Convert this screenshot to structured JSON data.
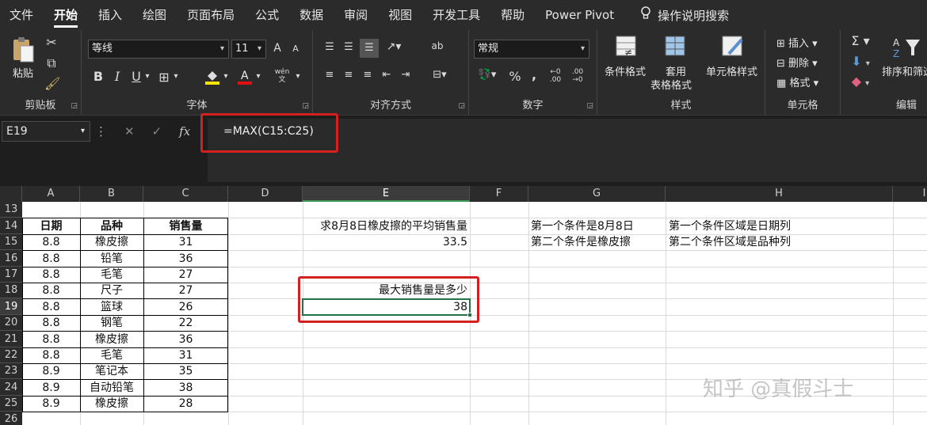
{
  "menu": {
    "tabs": [
      "文件",
      "开始",
      "插入",
      "绘图",
      "页面布局",
      "公式",
      "数据",
      "审阅",
      "视图",
      "开发工具",
      "帮助",
      "Power Pivot"
    ],
    "active_tab": "开始",
    "search_label": "操作说明搜索"
  },
  "ribbon": {
    "clipboard": {
      "paste": "粘贴",
      "label": "剪贴板"
    },
    "font": {
      "name": "等线",
      "size": "11",
      "label": "字体",
      "bold": "B",
      "italic": "I",
      "underline": "U",
      "grow": "A",
      "shrink": "A",
      "wen": "wén"
    },
    "alignment": {
      "label": "对齐方式",
      "wrap": "ab"
    },
    "number": {
      "format": "常规",
      "label": "数字",
      "percent": "%",
      "comma": ","
    },
    "styles": {
      "conditional": "条件格式",
      "table_line1": "套用",
      "table_line2": "表格格式",
      "cell_styles": "单元格样式",
      "label": "样式"
    },
    "cells": {
      "insert": "插入",
      "delete": "删除",
      "format": "格式",
      "label": "单元格"
    },
    "editing": {
      "sort": "排序和筛选",
      "label": "编辑",
      "sigma": "Σ"
    }
  },
  "formula_bar": {
    "name_box": "E19",
    "fx": "fx",
    "formula": "=MAX(C15:C25)"
  },
  "columns": [
    "A",
    "B",
    "C",
    "D",
    "E",
    "F",
    "G",
    "H",
    "I"
  ],
  "rows": [
    "13",
    "14",
    "15",
    "16",
    "17",
    "18",
    "19",
    "20",
    "21",
    "22",
    "23",
    "24",
    "25",
    "26"
  ],
  "table": {
    "headers": [
      "日期",
      "品种",
      "销售量"
    ],
    "rows": [
      [
        "8.8",
        "橡皮擦",
        "31"
      ],
      [
        "8.8",
        "铅笔",
        "36"
      ],
      [
        "8.8",
        "毛笔",
        "27"
      ],
      [
        "8.8",
        "尺子",
        "27"
      ],
      [
        "8.8",
        "篮球",
        "26"
      ],
      [
        "8.8",
        "钢笔",
        "22"
      ],
      [
        "8.8",
        "橡皮擦",
        "36"
      ],
      [
        "8.8",
        "毛笔",
        "31"
      ],
      [
        "8.9",
        "笔记本",
        "35"
      ],
      [
        "8.9",
        "自动铅笔",
        "38"
      ],
      [
        "8.9",
        "橡皮擦",
        "28"
      ]
    ]
  },
  "cells": {
    "E14": "求8月8日橡皮擦的平均销售量",
    "E15": "33.5",
    "E18": "最大销售量是多少",
    "E19": "38",
    "G14": "第一个条件是8月8日",
    "G15": "第二个条件是橡皮擦",
    "H14": "第一个条件区域是日期列",
    "H15": "第二个条件区域是品种列"
  },
  "watermark": "知乎 @真假斗士",
  "colors": {
    "highlight_border": "#d32020",
    "active_cell": "#217346"
  }
}
